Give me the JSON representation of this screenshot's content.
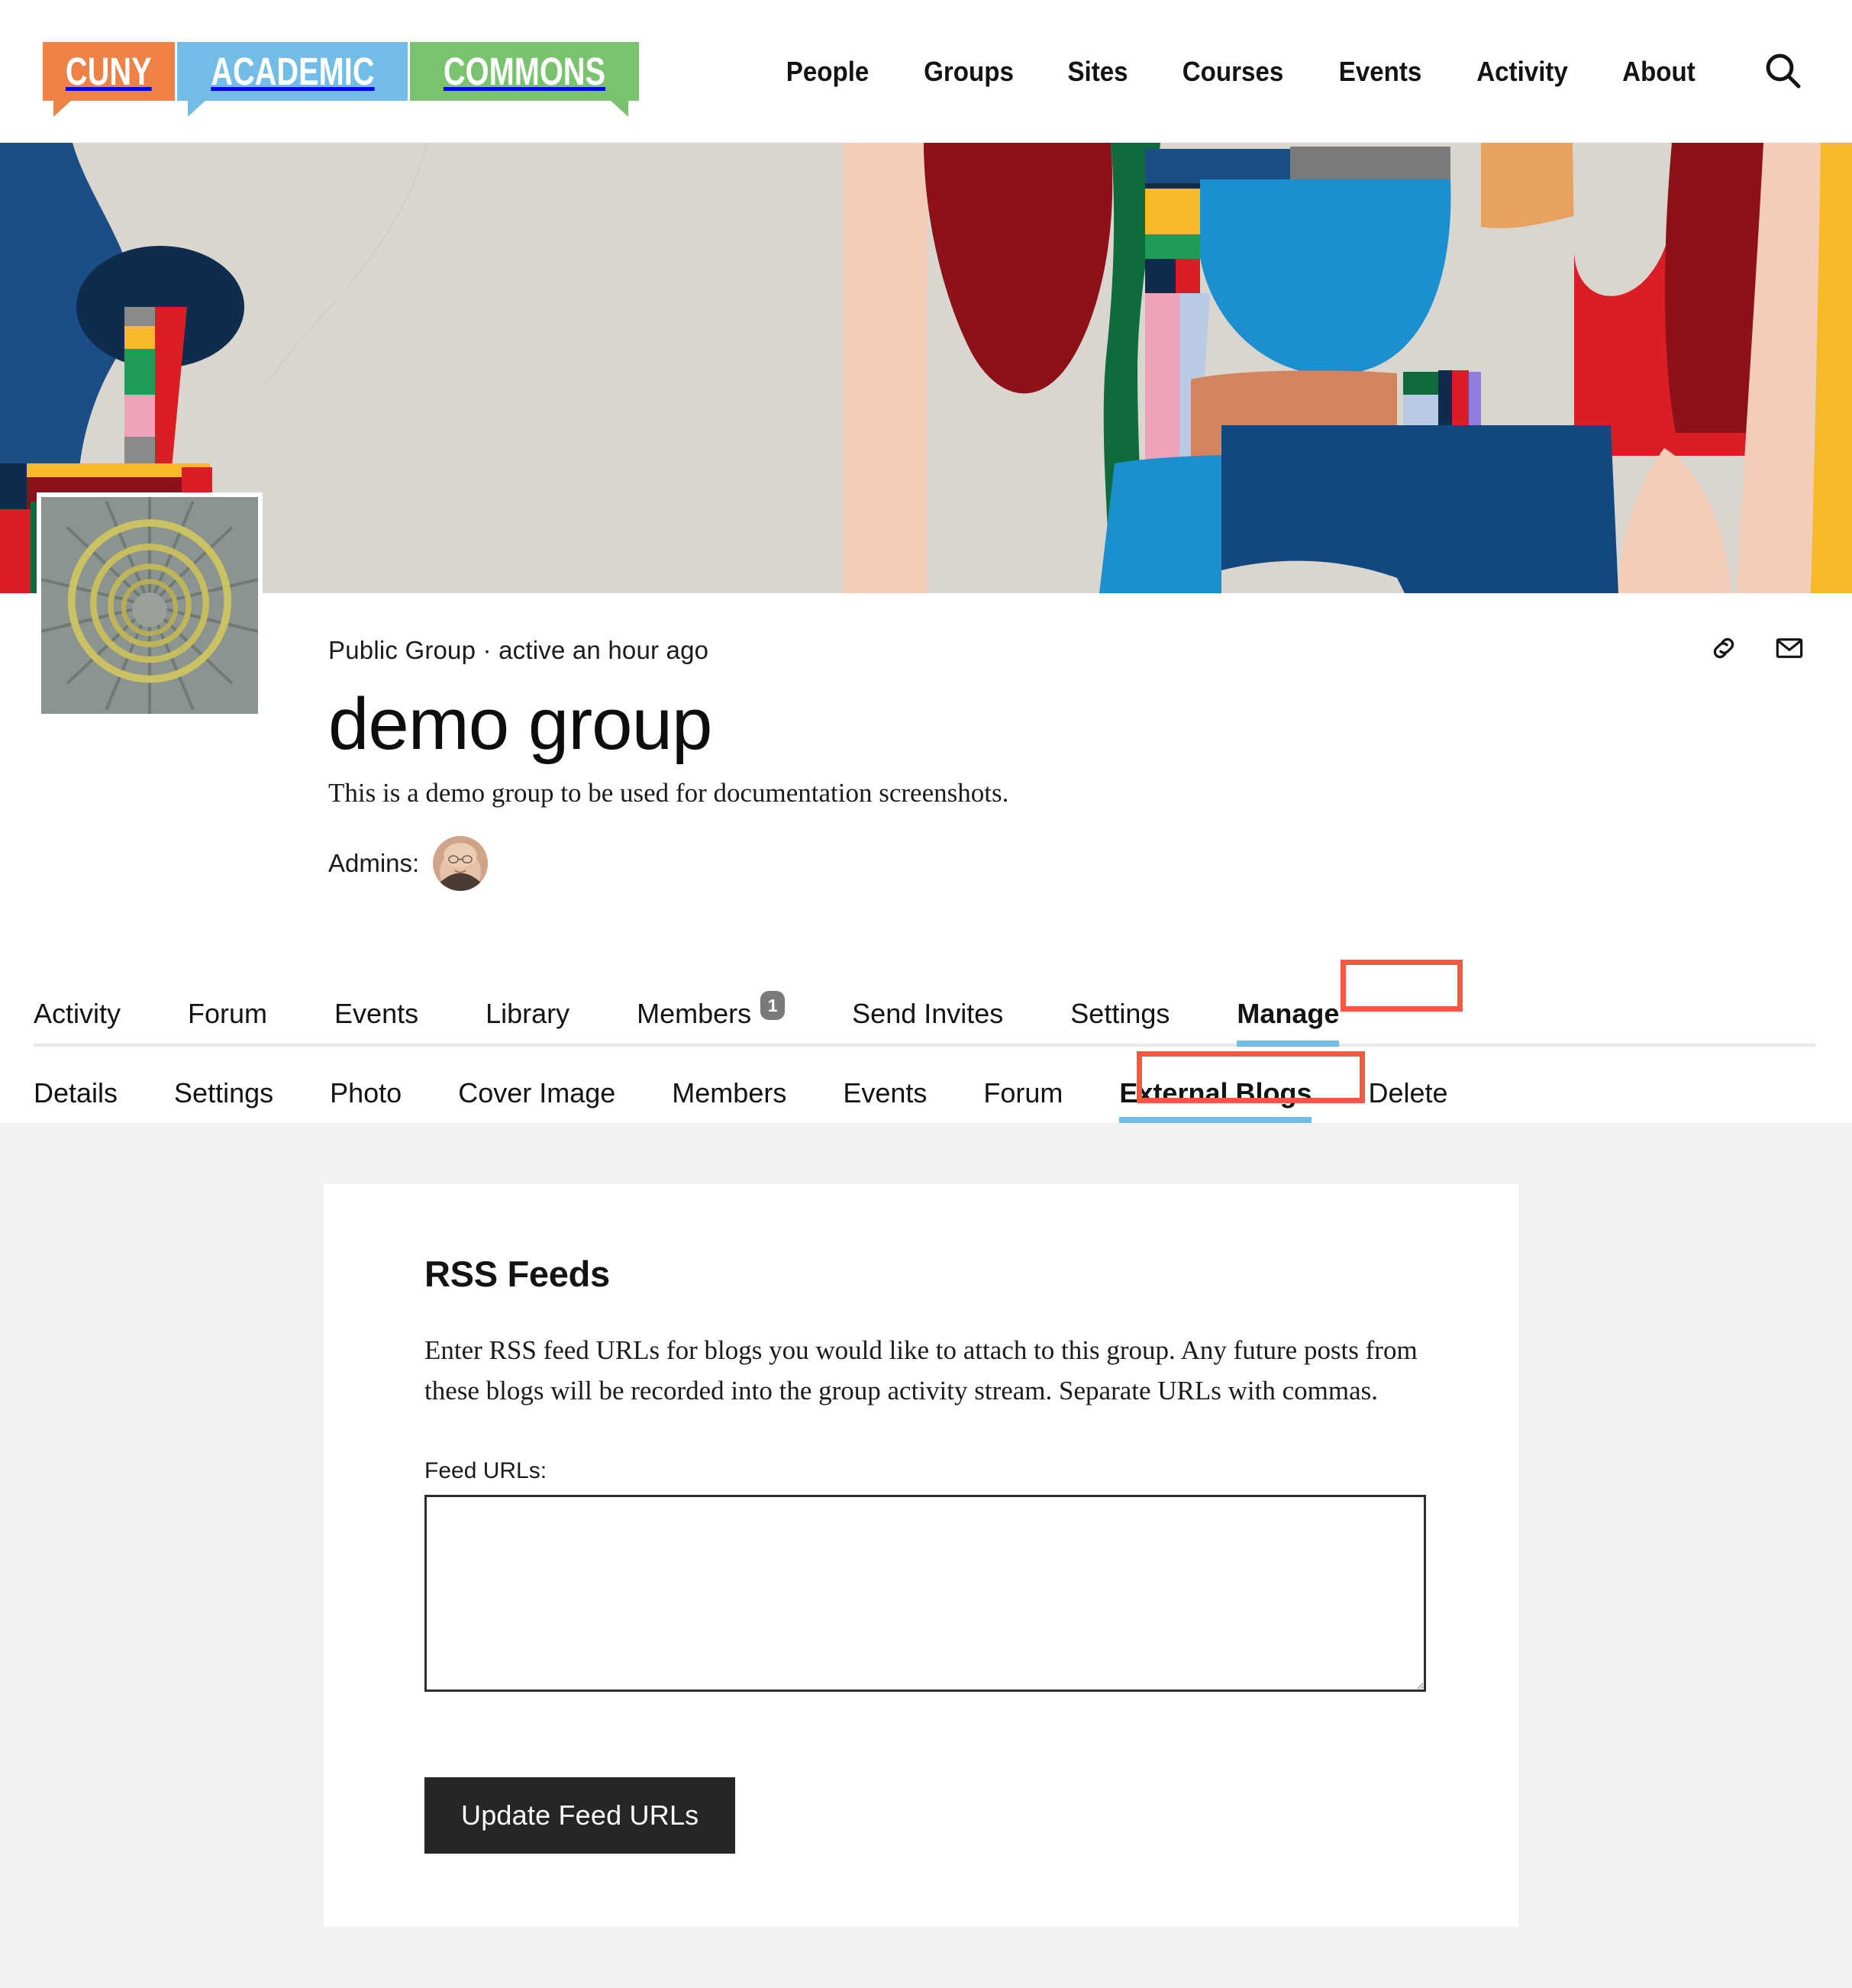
{
  "header": {
    "logo": {
      "part1": "CUNY",
      "part2": "ACADEMIC",
      "part3": "COMMONS",
      "color1": "#ee8146",
      "color2": "#72bce8",
      "color3": "#79c36f"
    },
    "nav": [
      {
        "label": "People"
      },
      {
        "label": "Groups"
      },
      {
        "label": "Sites"
      },
      {
        "label": "Courses"
      },
      {
        "label": "Events"
      },
      {
        "label": "Activity"
      },
      {
        "label": "About"
      }
    ],
    "search_icon": "search-icon"
  },
  "cover": {
    "alt": "abstract colorful cover artwork",
    "palette": [
      "#1b4d86",
      "#d9d5cf",
      "#f4cdb8",
      "#8d1118",
      "#0e6b3c",
      "#1b8fd0",
      "#e8a15f",
      "#f5b92a",
      "#0e2d4d",
      "#d91e25"
    ]
  },
  "group": {
    "avatar_alt": "spiral staircase viewed from above",
    "meta": "Public Group · active an hour ago",
    "title": "demo group",
    "description": "This is a demo group to be used for documentation screenshots.",
    "admins_label": "Admins:",
    "admin_avatar_alt": "group admin profile photo",
    "actions": [
      {
        "name": "copy-link-icon"
      },
      {
        "name": "email-icon"
      }
    ]
  },
  "tabs_primary": [
    {
      "label": "Activity",
      "active": false
    },
    {
      "label": "Forum",
      "active": false
    },
    {
      "label": "Events",
      "active": false
    },
    {
      "label": "Library",
      "active": false
    },
    {
      "label": "Members",
      "active": false,
      "badge": "1"
    },
    {
      "label": "Send Invites",
      "active": false
    },
    {
      "label": "Settings",
      "active": false
    },
    {
      "label": "Manage",
      "active": true,
      "highlighted": true
    }
  ],
  "tabs_secondary": [
    {
      "label": "Details",
      "active": false
    },
    {
      "label": "Settings",
      "active": false
    },
    {
      "label": "Photo",
      "active": false
    },
    {
      "label": "Cover Image",
      "active": false
    },
    {
      "label": "Members",
      "active": false
    },
    {
      "label": "Events",
      "active": false
    },
    {
      "label": "Forum",
      "active": false
    },
    {
      "label": "External Blogs",
      "active": true,
      "highlighted": true
    },
    {
      "label": "Delete",
      "active": false
    }
  ],
  "panel": {
    "heading": "RSS Feeds",
    "body": "Enter RSS feed URLs for blogs you would like to attach to this group. Any future posts from these blogs will be recorded into the group activity stream. Separate URLs with commas.",
    "field_label": "Feed URLs:",
    "field_value": "",
    "field_placeholder": "",
    "submit_label": "Update Feed URLs"
  },
  "colors": {
    "annotation": "#f4593f",
    "active_underline": "#72bce8",
    "button_bg": "#262626",
    "page_bg": "#f2f2f2",
    "badge_bg": "#7a7a7a"
  }
}
